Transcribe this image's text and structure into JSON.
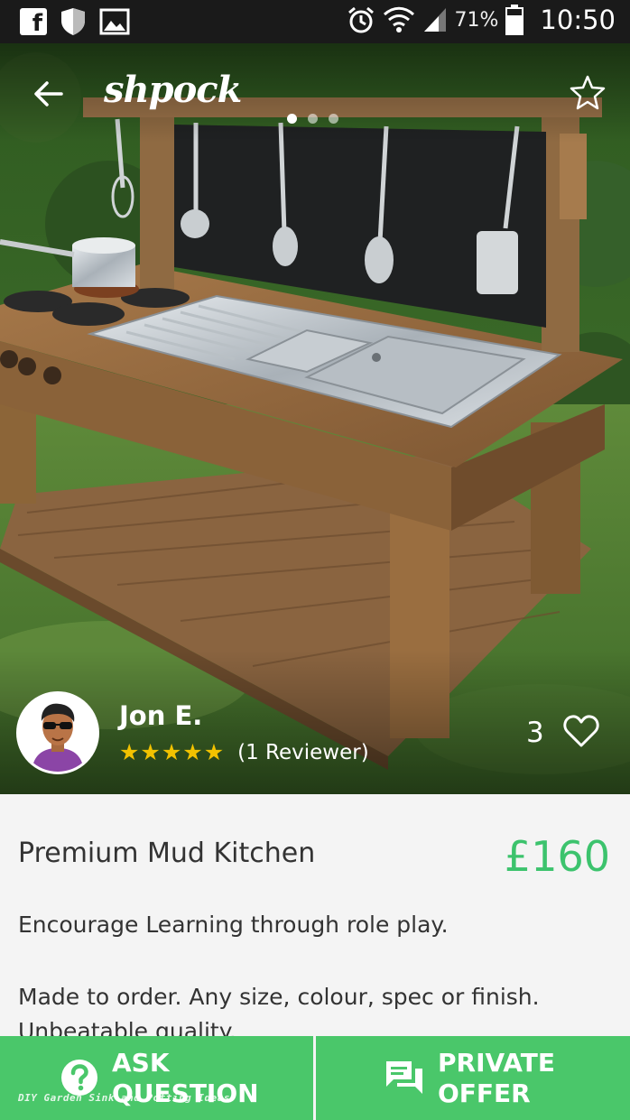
{
  "status_bar": {
    "icons_left": [
      "facebook-icon",
      "shield-icon",
      "image-icon"
    ],
    "icons_right": [
      "alarm-icon",
      "wifi-icon",
      "signal-icon",
      "battery-icon"
    ],
    "battery": "71%",
    "time": "10:50"
  },
  "header": {
    "logo": "shpock",
    "back_icon": "arrow-left-icon",
    "favorite_icon": "star-outline-icon",
    "carousel": {
      "total": 3,
      "active": 1
    }
  },
  "seller": {
    "name": "Jon E.",
    "stars": 5,
    "reviewers": "(1 Reviewer)",
    "likes": "3"
  },
  "listing": {
    "title": "Premium Mud Kitchen",
    "price": "£160",
    "description": [
      "Encourage Learning through role play.",
      "",
      "Made to order. Any size, colour, spec or finish.",
      "Unbeatable quality."
    ]
  },
  "actions": {
    "ask_line1": "ASK",
    "ask_line2": "QUESTION",
    "offer_line1": "PRIVATE",
    "offer_line2": "OFFER"
  },
  "watermark": "DIY Garden Sink and Potting Ideas",
  "colors": {
    "accent_green": "#4ac76a",
    "price_green": "#3cc36d",
    "star_yellow": "#f2c200",
    "status_bar": "#1a1a1a"
  }
}
